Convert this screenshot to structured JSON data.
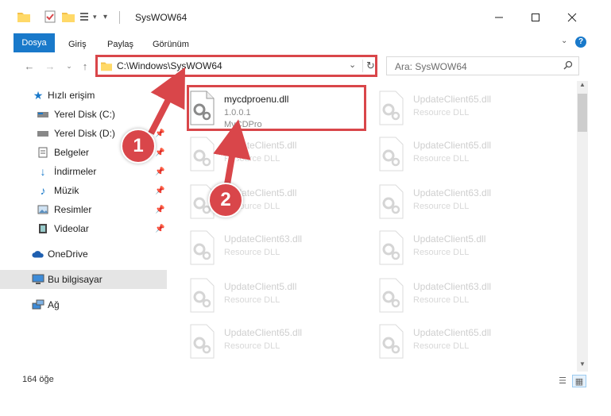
{
  "window": {
    "title": "SysWOW64"
  },
  "ribbon": {
    "tabs": [
      "Dosya",
      "Giriş",
      "Paylaş",
      "Görünüm"
    ],
    "help": "?"
  },
  "address": {
    "path": "C:\\Windows\\SysWOW64",
    "refresh": "↻"
  },
  "search": {
    "placeholder": "Ara: SysWOW64"
  },
  "sidebar": {
    "items": [
      {
        "label": "Hızlı erişim"
      },
      {
        "label": "Yerel Disk (C:)"
      },
      {
        "label": "Yerel Disk (D:)"
      },
      {
        "label": "Belgeler"
      },
      {
        "label": "İndirmeler"
      },
      {
        "label": "Müzik"
      },
      {
        "label": "Resimler"
      },
      {
        "label": "Videolar"
      },
      {
        "label": "OneDrive"
      },
      {
        "label": "Bu bilgisayar"
      },
      {
        "label": "Ağ"
      }
    ]
  },
  "files": [
    {
      "name": "mycdproenu.dll",
      "version": "1.0.0.1",
      "company": "MyCDPro"
    },
    {
      "name": "UpdateClient65.dll",
      "desc": "Resource DLL"
    },
    {
      "name": "UpdateClient5.dll",
      "desc": "Resource DLL"
    },
    {
      "name": "UpdateClient65.dll",
      "desc": "Resource DLL"
    },
    {
      "name": "UpdateClient5.dll",
      "desc": "Resource DLL"
    },
    {
      "name": "UpdateClient63.dll",
      "desc": "Resource DLL"
    },
    {
      "name": "UpdateClient63.dll",
      "desc": "Resource DLL"
    },
    {
      "name": "UpdateClient5.dll",
      "desc": "Resource DLL"
    },
    {
      "name": "UpdateClient5.dll",
      "desc": "Resource DLL"
    },
    {
      "name": "UpdateClient63.dll",
      "desc": "Resource DLL"
    },
    {
      "name": "UpdateClient65.dll",
      "desc": "Resource DLL"
    },
    {
      "name": "UpdateClient65.dll",
      "desc": "Resource DLL"
    }
  ],
  "status": {
    "count": "164 öğe"
  },
  "callouts": [
    "1",
    "2"
  ],
  "colors": {
    "accent": "#1979ca",
    "highlight": "#d9464a"
  }
}
